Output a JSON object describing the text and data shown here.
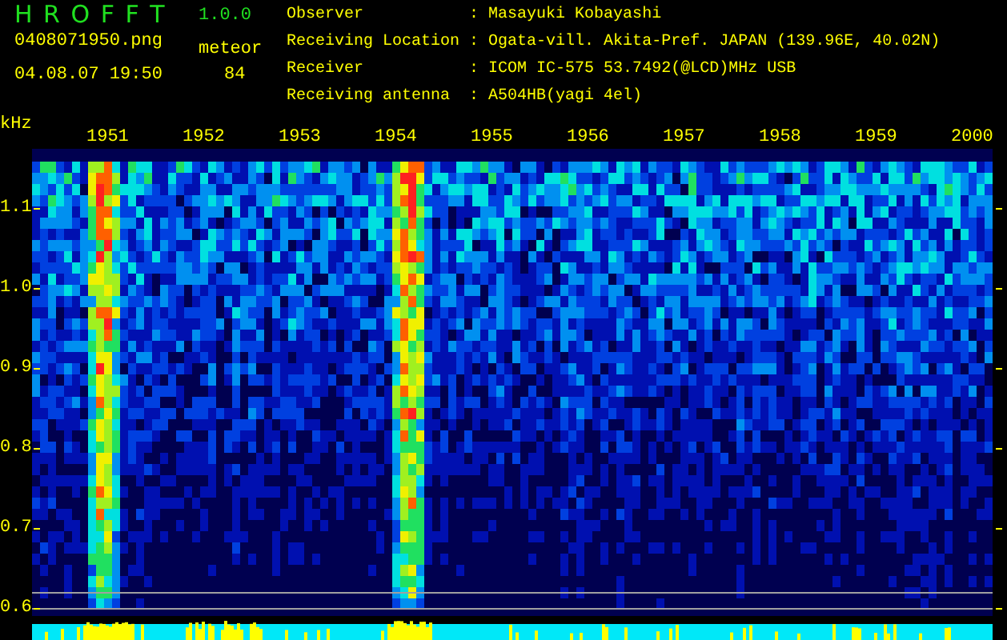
{
  "app": {
    "title": "H R O F F T",
    "version": "1.0.0"
  },
  "file": {
    "filename": "0408071950.png",
    "timestamp": "04.08.07 19:50"
  },
  "meteor": {
    "label": "meteor",
    "count": "84"
  },
  "info": [
    {
      "label": "Observer",
      "separator": ":",
      "value": "Masayuki Kobayashi"
    },
    {
      "label": "Receiving Location",
      "separator": ":",
      "value": "Ogata-vill. Akita-Pref. JAPAN (139.96E, 40.02N)"
    },
    {
      "label": "Receiver",
      "separator": ":",
      "value": "ICOM IC-575 53.7492(@LCD)MHz USB"
    },
    {
      "label": "Receiving antenna",
      "separator": ":",
      "value": "A504HB(yagi 4el)"
    }
  ],
  "spectrogram": {
    "unit": "kHz",
    "yticks": [
      "1.1",
      "1.0",
      "0.9",
      "0.8",
      "0.7",
      "0.6"
    ],
    "xticks": [
      "1951",
      "1952",
      "1953",
      "1954",
      "1955",
      "1956",
      "1957",
      "1958",
      "1959",
      "2000"
    ]
  }
}
